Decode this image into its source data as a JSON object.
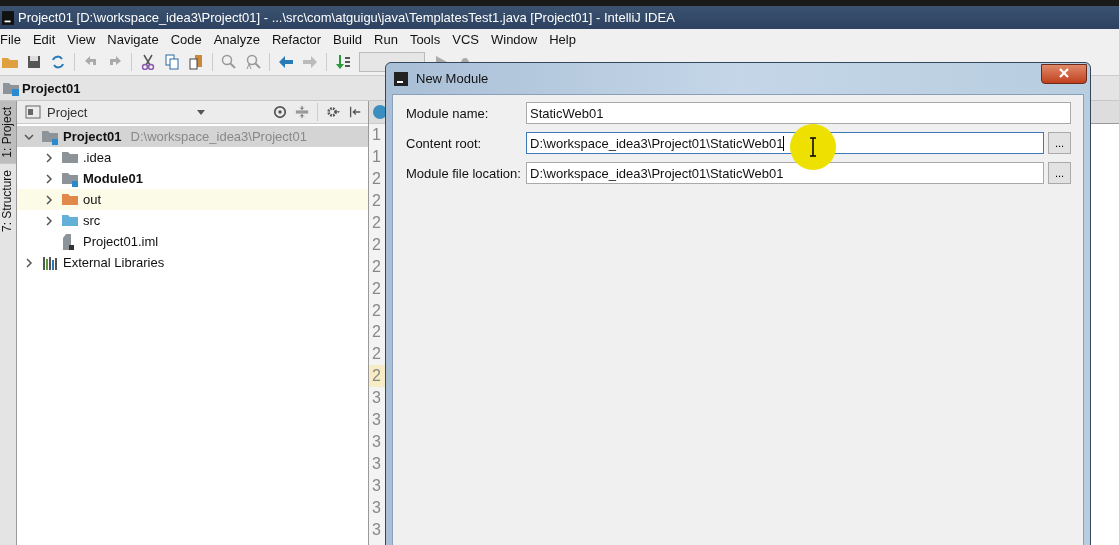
{
  "window": {
    "title": "Project01 [D:\\workspace_idea3\\Project01] - ...\\src\\com\\atguigu\\java\\TemplatesTest1.java [Project01] - IntelliJ IDEA"
  },
  "menu": [
    "File",
    "Edit",
    "View",
    "Navigate",
    "Code",
    "Analyze",
    "Refactor",
    "Build",
    "Run",
    "Tools",
    "VCS",
    "Window",
    "Help"
  ],
  "breadcrumb": "Project01",
  "tool_stripe": [
    {
      "label": "1: Project",
      "selected": true
    },
    {
      "label": "7: Structure",
      "selected": false
    }
  ],
  "project_panel": {
    "title": "Project",
    "tree": [
      {
        "label": "Project01",
        "path": "D:\\workspace_idea3\\Project01",
        "kind": "project",
        "bold": true,
        "expanded": true,
        "selected": true,
        "highlighted": false,
        "children": [
          {
            "label": ".idea",
            "kind": "folder",
            "color": "#8c9399",
            "bold": false,
            "expanded": false,
            "selected": false,
            "highlighted": false
          },
          {
            "label": "Module01",
            "kind": "module",
            "color": "#8c9399",
            "bold": true,
            "expanded": false,
            "selected": false,
            "highlighted": false
          },
          {
            "label": "out",
            "kind": "folder",
            "color": "#e0894a",
            "bold": false,
            "expanded": false,
            "selected": false,
            "highlighted": true
          },
          {
            "label": "src",
            "kind": "folder",
            "color": "#62b0d6",
            "bold": false,
            "expanded": false,
            "selected": false,
            "highlighted": false
          },
          {
            "label": "Project01.iml",
            "kind": "file",
            "bold": false,
            "selected": false,
            "highlighted": false
          }
        ]
      },
      {
        "label": "External Libraries",
        "kind": "libraries",
        "bold": false,
        "expanded": false,
        "selected": false,
        "highlighted": false
      }
    ]
  },
  "gutter": [
    {
      "number": "1",
      "current": false
    },
    {
      "number": "1",
      "current": false
    },
    {
      "number": "2",
      "current": false
    },
    {
      "number": "2",
      "current": false
    },
    {
      "number": "2",
      "current": false
    },
    {
      "number": "2",
      "current": false
    },
    {
      "number": "2",
      "current": false
    },
    {
      "number": "2",
      "current": false
    },
    {
      "number": "2",
      "current": false
    },
    {
      "number": "2",
      "current": false
    },
    {
      "number": "2",
      "current": false
    },
    {
      "number": "2",
      "current": true
    },
    {
      "number": "3",
      "current": false
    },
    {
      "number": "3",
      "current": false
    },
    {
      "number": "3",
      "current": false
    },
    {
      "number": "3",
      "current": false
    },
    {
      "number": "3",
      "current": false
    },
    {
      "number": "3",
      "current": false
    },
    {
      "number": "3",
      "current": false
    }
  ],
  "dialog": {
    "title": "New Module",
    "fields": [
      {
        "label": "Module name:",
        "value": "StaticWeb01",
        "focused": false
      },
      {
        "label": "Content root:",
        "value": "D:\\workspace_idea3\\Project01\\StaticWeb01",
        "focused": true,
        "browse_button": "..."
      },
      {
        "label": "Module file location:",
        "value": "D:\\workspace_idea3\\Project01\\StaticWeb01",
        "focused": false,
        "browse_button": "..."
      }
    ]
  }
}
